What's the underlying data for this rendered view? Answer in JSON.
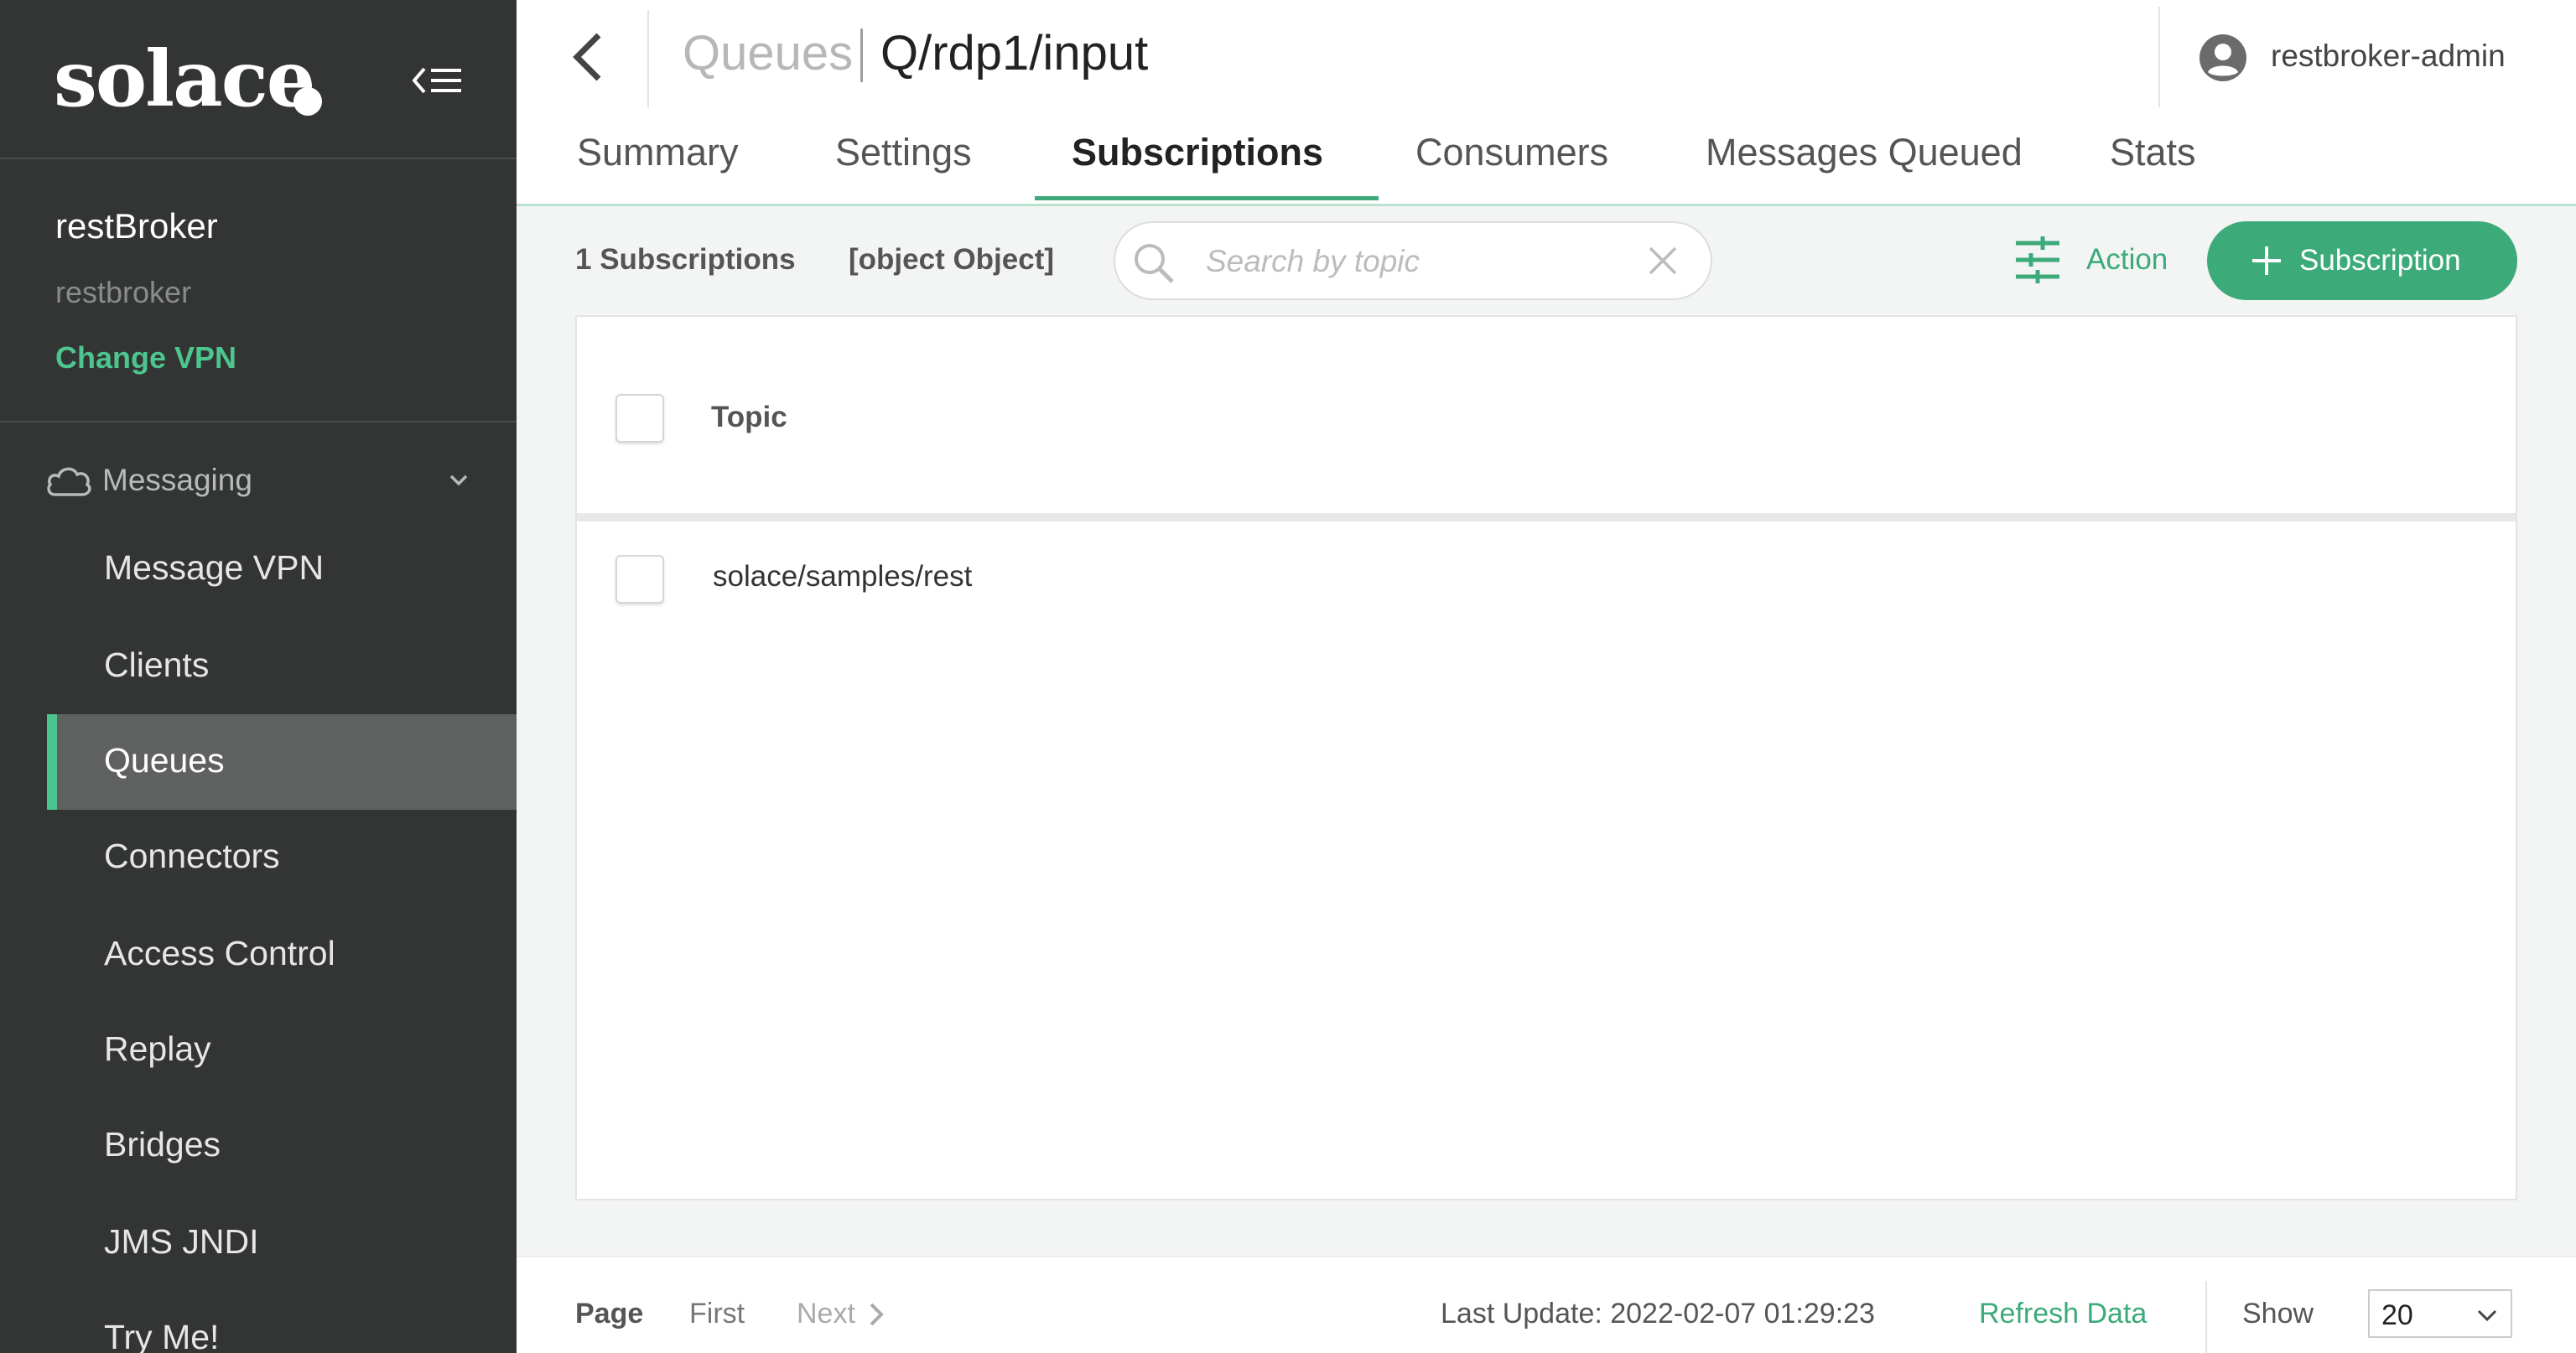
{
  "brand": {
    "logo_text": "solace"
  },
  "vpn": {
    "name": "restBroker",
    "sub_label": "restbroker",
    "change_label": "Change VPN"
  },
  "sidebar": {
    "section_label": "Messaging",
    "items": [
      {
        "label": "Message VPN",
        "active": false
      },
      {
        "label": "Clients",
        "active": false
      },
      {
        "label": "Queues",
        "active": true
      },
      {
        "label": "Connectors",
        "active": false
      },
      {
        "label": "Access Control",
        "active": false
      },
      {
        "label": "Replay",
        "active": false
      },
      {
        "label": "Bridges",
        "active": false
      },
      {
        "label": "JMS JNDI",
        "active": false
      },
      {
        "label": "Try Me!",
        "active": false
      }
    ]
  },
  "header": {
    "breadcrumb_parent": "Queues",
    "breadcrumb_current": "Q/rdp1/input",
    "user_name": "restbroker-admin"
  },
  "tabs": [
    {
      "label": "Summary",
      "active": false
    },
    {
      "label": "Settings",
      "active": false
    },
    {
      "label": "Subscriptions",
      "active": true
    },
    {
      "label": "Consumers",
      "active": false
    },
    {
      "label": "Messages Queued",
      "active": false
    },
    {
      "label": "Stats",
      "active": false
    }
  ],
  "toolbar": {
    "count_label": "1 Subscriptions",
    "object_label": "[object Object]",
    "search_placeholder": "Search by topic",
    "search_value": "",
    "action_label": "Action",
    "add_label": "Subscription"
  },
  "table": {
    "column_header": "Topic",
    "rows": [
      {
        "topic": "solace/samples/rest"
      }
    ]
  },
  "footer": {
    "page_label": "Page",
    "first_label": "First",
    "next_label": "Next",
    "last_update": "Last Update: 2022-02-07 01:29:23",
    "refresh_label": "Refresh Data",
    "show_label": "Show",
    "page_size": "20"
  },
  "colors": {
    "accent": "#3daa7a",
    "sidebar_bg": "#333434",
    "active_nav_bg": "#5f6060"
  }
}
